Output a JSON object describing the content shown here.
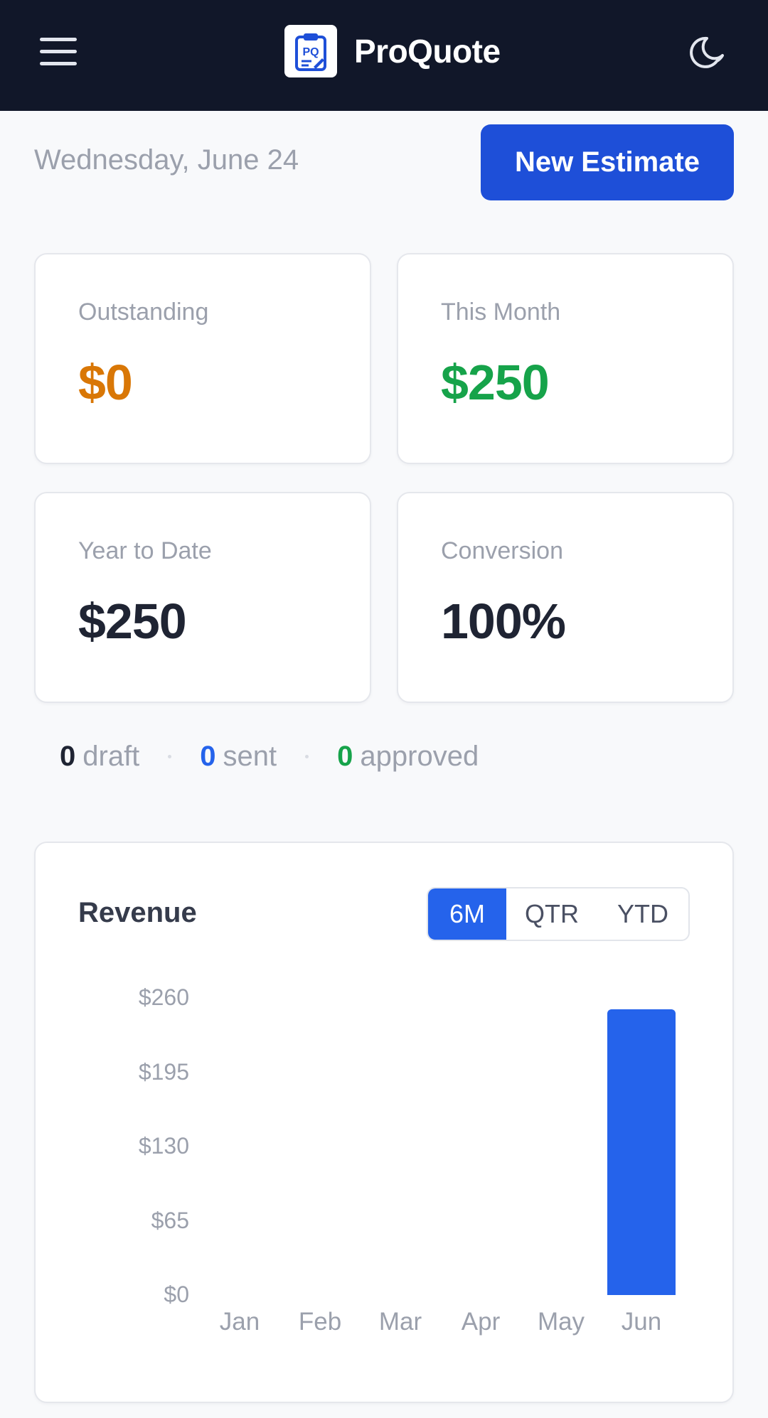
{
  "header": {
    "brand": "ProQuote",
    "logo_text": "PQ",
    "menu_icon": "hamburger-menu-icon",
    "theme_icon": "moon-icon"
  },
  "toolbar": {
    "date": "Wednesday, June 24",
    "new_estimate_label": "New Estimate"
  },
  "stats": [
    {
      "label": "Outstanding",
      "value": "$0",
      "color": "#d97706"
    },
    {
      "label": "This Month",
      "value": "$250",
      "color": "#16a34a"
    },
    {
      "label": "Year to Date",
      "value": "$250",
      "color": "#1f2433"
    },
    {
      "label": "Conversion",
      "value": "100%",
      "color": "#1f2433"
    }
  ],
  "counts": {
    "draft": {
      "value": "0",
      "label": "draft",
      "color": "#1f2433"
    },
    "sent": {
      "value": "0",
      "label": "sent",
      "color": "#2563eb"
    },
    "approved": {
      "value": "0",
      "label": "approved",
      "color": "#16a34a"
    }
  },
  "revenue": {
    "title": "Revenue",
    "ranges": [
      "6M",
      "QTR",
      "YTD"
    ],
    "active_range": "6M"
  },
  "colors": {
    "header_bg": "#111729",
    "primary": "#1e4fd8",
    "bar": "#2563eb"
  },
  "chart_data": {
    "type": "bar",
    "categories": [
      "Jan",
      "Feb",
      "Mar",
      "Apr",
      "May",
      "Jun"
    ],
    "values": [
      0,
      0,
      0,
      0,
      0,
      250
    ],
    "yticks": [
      "$0",
      "$65",
      "$130",
      "$195",
      "$260"
    ],
    "ylim": [
      0,
      260
    ],
    "title": "",
    "xlabel": "",
    "ylabel": "",
    "grid": false
  }
}
